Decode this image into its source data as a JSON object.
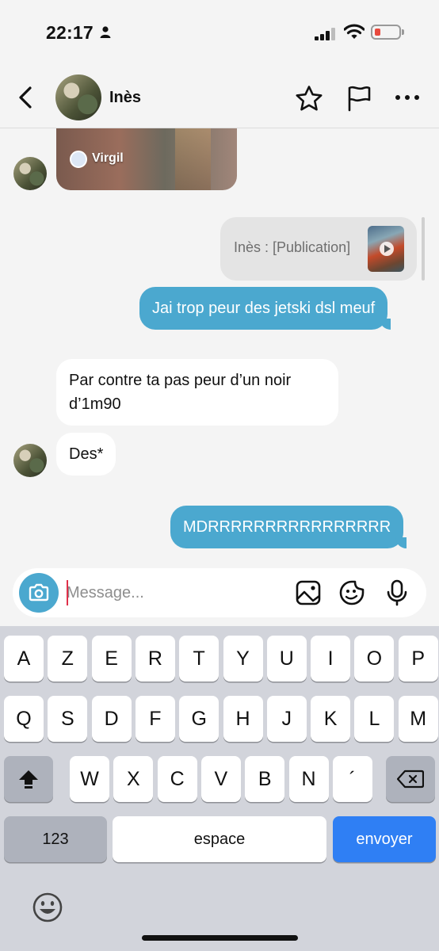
{
  "status_bar": {
    "time": "22:17",
    "battery_color": "#e84a3e"
  },
  "header": {
    "contact_name": "Inès",
    "icons": [
      "back-icon",
      "star-icon",
      "flag-icon",
      "more-icon"
    ]
  },
  "messages": [
    {
      "type": "media",
      "direction": "incoming",
      "author": "Virgil"
    },
    {
      "type": "shared_post",
      "direction": "outgoing",
      "text": "Inès : [Publication]"
    },
    {
      "type": "text",
      "direction": "outgoing",
      "text": "Jai trop peur des jetski dsl meuf"
    },
    {
      "type": "text",
      "direction": "incoming",
      "lines": [
        "Par contre ta pas peur d’un noir",
        "d’1m90"
      ]
    },
    {
      "type": "text",
      "direction": "incoming",
      "text": "Des*"
    },
    {
      "type": "text",
      "direction": "outgoing",
      "text": "MDRRRRRRRRRRRRRRRR"
    }
  ],
  "composer": {
    "placeholder": "Message...",
    "value": "",
    "icons": [
      "camera-icon",
      "gallery-icon",
      "sticker-icon",
      "microphone-icon"
    ]
  },
  "keyboard": {
    "row1": [
      "A",
      "Z",
      "E",
      "R",
      "T",
      "Y",
      "U",
      "I",
      "O",
      "P"
    ],
    "row2": [
      "Q",
      "S",
      "D",
      "F",
      "G",
      "H",
      "J",
      "K",
      "L",
      "M"
    ],
    "row3": [
      "W",
      "X",
      "C",
      "V",
      "B",
      "N",
      "´"
    ],
    "numbers_label": "123",
    "space_label": "espace",
    "send_label": "envoyer"
  },
  "colors": {
    "outgoing_bubble": "#4ba8cf",
    "incoming_bubble": "#ffffff",
    "send_key": "#2f7ff4"
  }
}
